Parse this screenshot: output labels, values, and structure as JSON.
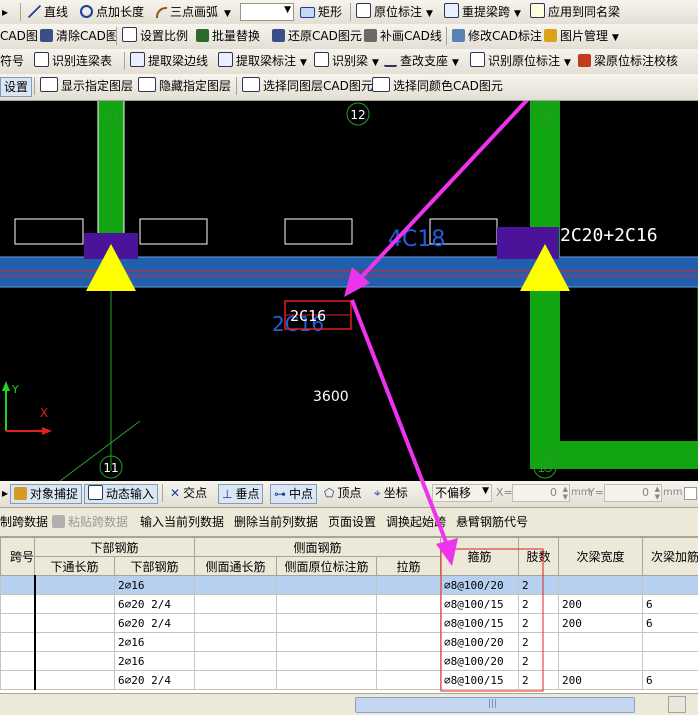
{
  "toolbar1": {
    "line": "直线",
    "point_length": "点加长度",
    "three_point_arc": "三点画弧",
    "rect": "矩形",
    "orig_annotation": "原位标注",
    "re_extract_span": "重提梁跨",
    "apply_same_name": "应用到同名梁"
  },
  "toolbar2": {
    "cad_drawing": "CAD图",
    "clear_cad": "清除CAD图",
    "set_ratio": "设置比例",
    "batch_replace": "批量替换",
    "restore_cad": "还原CAD图元",
    "fill_cad_line": "补画CAD线",
    "modify_cad_annotation": "修改CAD标注",
    "image_manage": "图片管理"
  },
  "toolbar3": {
    "symbol": "符号",
    "identify_link_table": "识别连梁表",
    "extract_beam_edge": "提取梁边线",
    "extract_beam_annotation": "提取梁标注",
    "identify_beam": "识别梁",
    "check_support": "查改支座",
    "identify_orig_annotation": "识别原位标注",
    "beam_annotation_check": "梁原位标注校核"
  },
  "toolbar4": {
    "settings": "设置",
    "show_layer": "显示指定图层",
    "hide_layer": "隐藏指定图层",
    "select_same_layer": "选择同图层CAD图元",
    "select_same_color": "选择同颜色CAD图元"
  },
  "canvas": {
    "axis_top_left": "11",
    "axis_top_mid": "12",
    "axis_top_right": "13",
    "axis_bottom_left": "11",
    "axis_bottom_right": "13",
    "blue_annotation": "4C18",
    "right_annotation": "2C20+2C16",
    "mid_annotation_white": "2C16",
    "mid_annotation_blue": "2C16",
    "dimension": "3600",
    "ucs_y": "Y",
    "ucs_x": "X",
    "colors": {
      "column_green": "#11a511",
      "beam_blue": "#1f5fae",
      "support_yellow": "#ffff00",
      "support_purple": "#4b139a",
      "arrow_magenta": "#ee33ee",
      "axis_green": "#23a023"
    }
  },
  "snapbar": {
    "object_snap": "对象捕捉",
    "dynamic_input": "动态输入",
    "intersection": "交点",
    "perpendicular": "垂点",
    "midpoint": "中点",
    "vertex": "顶点",
    "coordinate": "坐标",
    "offset": "不偏移",
    "x_label": "X=",
    "x_value": "0",
    "y_label": "Y=",
    "y_value": "0",
    "unit": "mm"
  },
  "table_toolbar": {
    "copy_span_data": "制跨数据",
    "paste_span_data": "粘贴跨数据",
    "input_current_col": "输入当前列数据",
    "delete_current_col": "删除当前列数据",
    "page_setup": "页面设置",
    "swap_start": "调换起始跨",
    "cantilever_code": "悬臂钢筋代号"
  },
  "table": {
    "group_headers": [
      "跨号",
      "下部钢筋",
      "侧面钢筋",
      "箍筋",
      "肢数",
      "次梁宽度",
      "次梁加筋"
    ],
    "sub_headers": [
      "下通长筋",
      "下部钢筋",
      "侧面通长筋",
      "侧面原位标注筋",
      "拉筋"
    ],
    "rows": [
      [
        "",
        "",
        "2⌀16",
        "",
        "",
        "",
        "⌀8@100/20",
        "2",
        "",
        ""
      ],
      [
        "",
        "",
        "6⌀20 2/4",
        "",
        "",
        "",
        "⌀8@100/15",
        "2",
        "200",
        "6"
      ],
      [
        "",
        "",
        "6⌀20 2/4",
        "",
        "",
        "",
        "⌀8@100/15",
        "2",
        "200",
        "6"
      ],
      [
        "",
        "",
        "2⌀16",
        "",
        "",
        "",
        "⌀8@100/20",
        "2",
        "",
        ""
      ],
      [
        "",
        "",
        "2⌀16",
        "",
        "",
        "",
        "⌀8@100/20",
        "2",
        "",
        ""
      ],
      [
        "",
        "",
        "6⌀20 2/4",
        "",
        "",
        "",
        "⌀8@100/15",
        "2",
        "200",
        "6"
      ]
    ]
  }
}
